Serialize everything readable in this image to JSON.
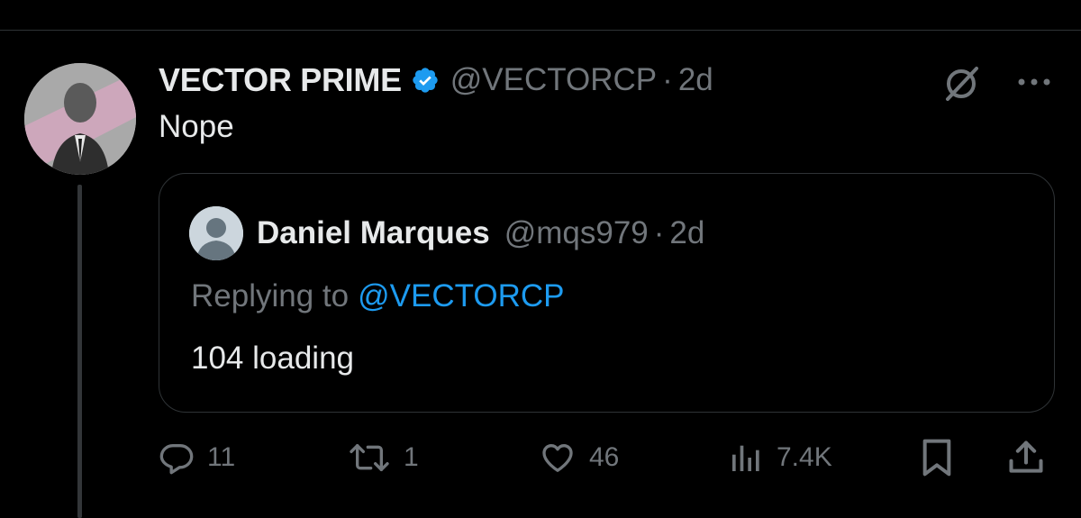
{
  "tweet": {
    "display_name": "VECTOR PRIME",
    "handle": "@VECTORCP",
    "separator": "·",
    "time": "2d",
    "text": "Nope",
    "verified": true
  },
  "quoted_tweet": {
    "display_name": "Daniel Marques",
    "handle": "@mqs979",
    "separator": "·",
    "time": "2d",
    "replying_prefix": "Replying to",
    "replying_handle": "@VECTORCP",
    "text": "104 loading"
  },
  "actions": {
    "reply_count": "11",
    "retweet_count": "1",
    "like_count": "46",
    "views_count": "7.4K"
  },
  "icons": {
    "verified": "verified-badge-icon",
    "grok": "grok-icon",
    "more": "more-icon",
    "reply": "reply-icon",
    "retweet": "retweet-icon",
    "like": "heart-icon",
    "views": "views-icon",
    "bookmark": "bookmark-icon",
    "share": "share-icon"
  },
  "colors": {
    "background": "#000000",
    "primary_text": "#e7e9ea",
    "secondary_text": "#71767b",
    "link": "#1d9bf0",
    "border": "#2f3336"
  }
}
